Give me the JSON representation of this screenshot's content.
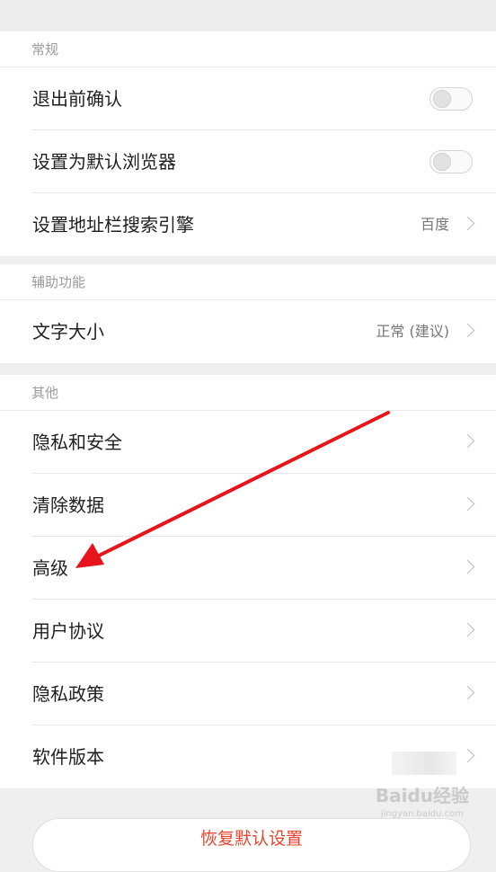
{
  "sections": {
    "general": {
      "header": "常规",
      "items": [
        {
          "label": "退出前确认",
          "control": "toggle",
          "checked": false
        },
        {
          "label": "设置为默认浏览器",
          "control": "toggle",
          "checked": false
        },
        {
          "label": "设置地址栏搜索引擎",
          "value": "百度",
          "control": "chevron"
        }
      ]
    },
    "accessibility": {
      "header": "辅助功能",
      "items": [
        {
          "label": "文字大小",
          "value": "正常 (建议)",
          "control": "chevron"
        }
      ]
    },
    "other": {
      "header": "其他",
      "items": [
        {
          "label": "隐私和安全",
          "control": "chevron"
        },
        {
          "label": "清除数据",
          "control": "chevron"
        },
        {
          "label": "高级",
          "control": "chevron"
        },
        {
          "label": "用户协议",
          "control": "chevron"
        },
        {
          "label": "隐私政策",
          "control": "chevron"
        },
        {
          "label": "软件版本",
          "control": "chevron"
        }
      ]
    }
  },
  "reset_button": {
    "label": "恢复默认设置"
  },
  "annotation": {
    "color": "#e8141c",
    "points_to": "高级"
  },
  "watermark": {
    "text": "Baidu经验",
    "subtext": "jingyan.baidu.com"
  },
  "colors": {
    "accent": "#e8452c"
  }
}
